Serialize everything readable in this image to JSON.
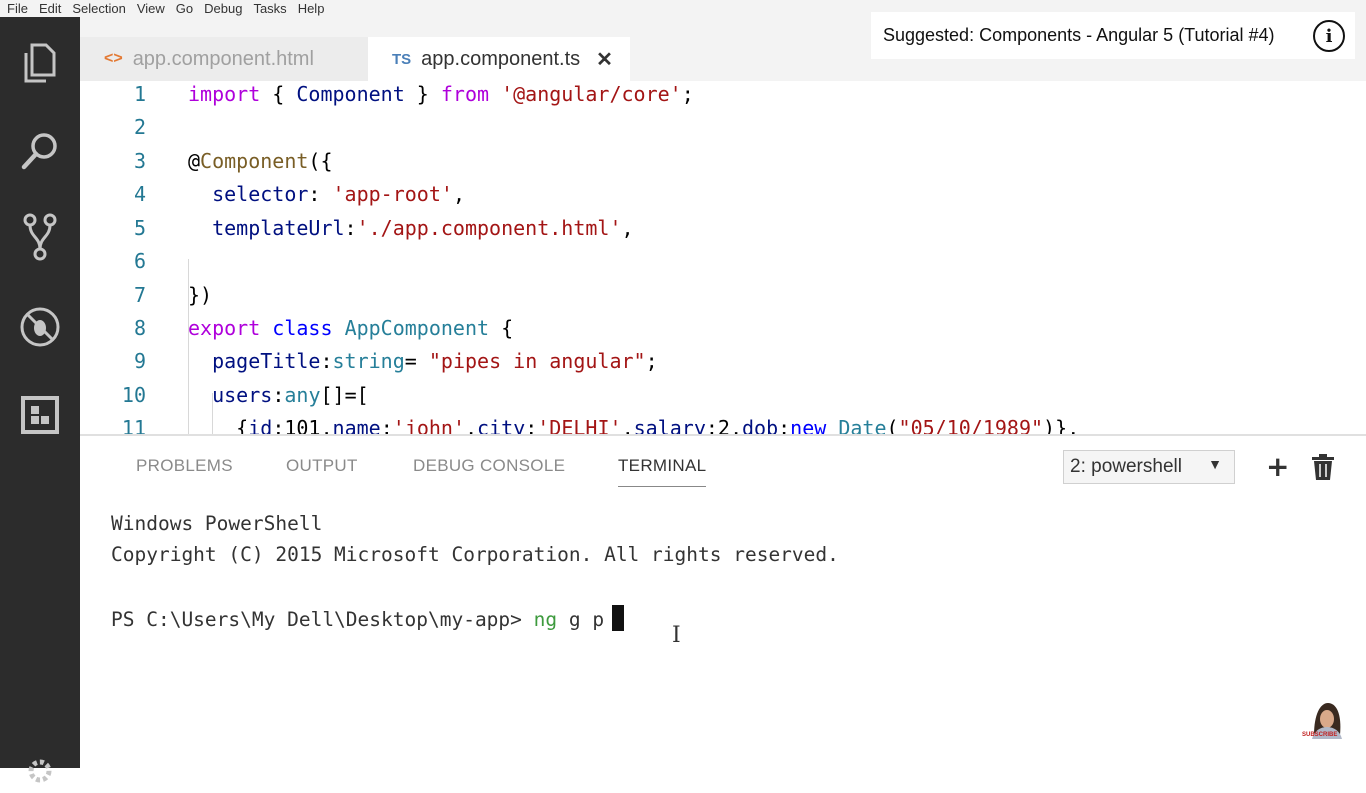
{
  "menu": [
    "File",
    "Edit",
    "Selection",
    "View",
    "Go",
    "Debug",
    "Tasks",
    "Help"
  ],
  "activity_icons": [
    "explorer-icon",
    "search-icon",
    "source-control-icon",
    "debug-icon",
    "extensions-icon",
    "gear-icon"
  ],
  "tabs": [
    {
      "icon": "<>",
      "label": "app.component.html"
    },
    {
      "icon": "TS",
      "label": "app.component.ts",
      "close": "✕"
    }
  ],
  "suggestion": {
    "text": "Suggested: Components - Angular 5 (Tutorial #4)",
    "info": "i"
  },
  "editor": {
    "line_numbers": [
      "1",
      "2",
      "3",
      "4",
      "5",
      "6",
      "7",
      "8",
      "9",
      "10",
      "11"
    ],
    "lines": [
      [
        {
          "c": "k",
          "t": "import"
        },
        {
          "c": "",
          "t": " { "
        },
        {
          "c": "p",
          "t": "Component"
        },
        {
          "c": "",
          "t": " } "
        },
        {
          "c": "k",
          "t": "from"
        },
        {
          "c": "",
          "t": " "
        },
        {
          "c": "s",
          "t": "'@angular/core'"
        },
        {
          "c": "",
          "t": ";"
        }
      ],
      [],
      [
        {
          "c": "",
          "t": "@"
        },
        {
          "c": "dc",
          "t": "Component"
        },
        {
          "c": "",
          "t": "({"
        }
      ],
      [
        {
          "c": "",
          "t": "  "
        },
        {
          "c": "p",
          "t": "selector"
        },
        {
          "c": "",
          "t": ": "
        },
        {
          "c": "s",
          "t": "'app-root'"
        },
        {
          "c": "",
          "t": ","
        }
      ],
      [
        {
          "c": "",
          "t": "  "
        },
        {
          "c": "p",
          "t": "templateUrl"
        },
        {
          "c": "",
          "t": ":"
        },
        {
          "c": "s",
          "t": "'./app.component.html'"
        },
        {
          "c": "",
          "t": ","
        }
      ],
      [],
      [
        {
          "c": "",
          "t": "})"
        }
      ],
      [
        {
          "c": "k",
          "t": "export"
        },
        {
          "c": "",
          "t": " "
        },
        {
          "c": "kb",
          "t": "class"
        },
        {
          "c": "",
          "t": " "
        },
        {
          "c": "t",
          "t": "AppComponent"
        },
        {
          "c": "",
          "t": " {"
        }
      ],
      [
        {
          "c": "",
          "t": "  "
        },
        {
          "c": "p",
          "t": "pageTitle"
        },
        {
          "c": "",
          "t": ":"
        },
        {
          "c": "t",
          "t": "string"
        },
        {
          "c": "",
          "t": "= "
        },
        {
          "c": "s",
          "t": "\"pipes in angular\""
        },
        {
          "c": "",
          "t": ";"
        }
      ],
      [
        {
          "c": "",
          "t": "  "
        },
        {
          "c": "p",
          "t": "users"
        },
        {
          "c": "",
          "t": ":"
        },
        {
          "c": "t",
          "t": "any"
        },
        {
          "c": "",
          "t": "[]=["
        }
      ],
      [
        {
          "c": "",
          "t": "    {"
        },
        {
          "c": "p",
          "t": "id"
        },
        {
          "c": "",
          "t": ":101,"
        },
        {
          "c": "p",
          "t": "name"
        },
        {
          "c": "",
          "t": ":"
        },
        {
          "c": "s",
          "t": "'john'"
        },
        {
          "c": "",
          "t": ","
        },
        {
          "c": "p",
          "t": "city"
        },
        {
          "c": "",
          "t": ":"
        },
        {
          "c": "s",
          "t": "'DELHI'"
        },
        {
          "c": "",
          "t": ","
        },
        {
          "c": "p",
          "t": "salary"
        },
        {
          "c": "",
          "t": ":2,"
        },
        {
          "c": "p",
          "t": "dob"
        },
        {
          "c": "",
          "t": ":"
        },
        {
          "c": "kb",
          "t": "new"
        },
        {
          "c": "",
          "t": " "
        },
        {
          "c": "t",
          "t": "Date"
        },
        {
          "c": "",
          "t": "("
        },
        {
          "c": "s",
          "t": "\"05/10/1989\""
        },
        {
          "c": "",
          "t": ")},"
        }
      ]
    ]
  },
  "panel": {
    "tabs": [
      "PROBLEMS",
      "OUTPUT",
      "DEBUG CONSOLE",
      "TERMINAL"
    ],
    "active_tab": "TERMINAL",
    "terminal_select": "2: powershell",
    "terminal_select_arrow": "▼",
    "add_label": "+",
    "terminal_lines": {
      "l1": "Windows PowerShell",
      "l2": "Copyright (C) 2015 Microsoft Corporation. All rights reserved.",
      "prompt": "PS C:\\Users\\My Dell\\Desktop\\my-app> ",
      "cmd": "ng",
      "args": " g p"
    }
  },
  "avatar_text": "SUBSCRIBE",
  "colors": {
    "keyword": "#af00db",
    "keyword_blue": "#0000ff",
    "type": "#267f99",
    "string": "#a31515",
    "property": "#001080",
    "line_number": "#237893",
    "command": "#3d9a3d",
    "activity_bar": "#2c2c2c"
  }
}
